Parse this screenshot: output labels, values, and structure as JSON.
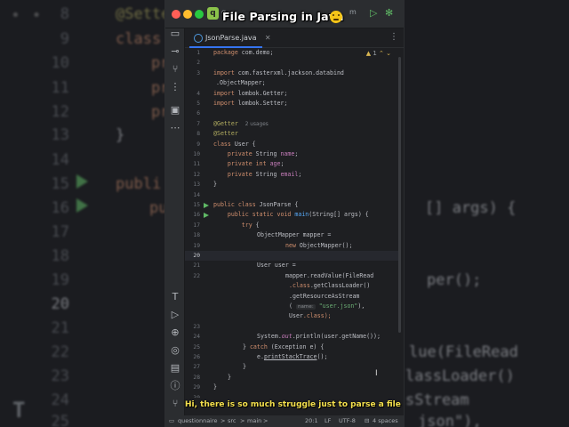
{
  "video_title": "File Parsing in Java",
  "window": {
    "project_badge": "q",
    "project_name_partial": "q",
    "menu_partial": "m"
  },
  "tab": {
    "label": "JsonParse.java"
  },
  "editor": {
    "warning_count": "1",
    "lines": [
      {
        "n": "1"
      },
      {
        "n": "2"
      },
      {
        "n": "3"
      },
      {
        "n": "4"
      },
      {
        "n": "5"
      },
      {
        "n": "6"
      },
      {
        "n": "7"
      },
      {
        "n": "8"
      },
      {
        "n": "9"
      },
      {
        "n": "10"
      },
      {
        "n": "11"
      },
      {
        "n": "12"
      },
      {
        "n": "13"
      },
      {
        "n": "14"
      },
      {
        "n": "15"
      },
      {
        "n": "16"
      },
      {
        "n": "17"
      },
      {
        "n": "18"
      },
      {
        "n": "19"
      },
      {
        "n": "20"
      },
      {
        "n": "21"
      },
      {
        "n": "22"
      },
      {
        "n": "23"
      },
      {
        "n": "24"
      },
      {
        "n": "25"
      },
      {
        "n": "26"
      },
      {
        "n": "27"
      },
      {
        "n": "28"
      },
      {
        "n": "29"
      },
      {
        "n": "30"
      }
    ],
    "code": {
      "package_kw": "package",
      "package_name": " com.demo;",
      "import_kw": "import",
      "import1a": " com.fasterxml.jackson.databind",
      "import1b": ".ObjectMapper;",
      "import2": " lombok.Getter;",
      "import3": " lombok.Setter;",
      "getter": "@Getter",
      "usages": "2 usages",
      "setter": "@Setter",
      "class_kw": "class",
      "class_user": " User {",
      "private_kw": "private",
      "int_kw": "int",
      "string_type": " String ",
      "f_name": "name",
      "f_age": "age",
      "f_email": "email",
      "semi": ";",
      "close_brace": "}",
      "public_kw": "public",
      "static_kw": "static",
      "void_kw": "void",
      "jsonparse_decl": " JsonParse {",
      "main_fn": "main",
      "main_args": "(String[] args) {",
      "try_kw": "try",
      "open_brace": " {",
      "mapper_decl": "ObjectMapper mapper =",
      "new_kw": "new",
      "new_mapper": " ObjectMapper();",
      "user_decl": "User user =",
      "read_value": "mapper.readValue(FileRead",
      "class_ref": ".class",
      "get_cl": ".getClassLoader()",
      "get_res": ".getResourceAsStream",
      "paren_open": "( ",
      "hint_name": "name:",
      "user_json": "\"user.json\"",
      "comma": "),",
      "user_class": "User",
      "class_end": ".class);",
      "sys_out": "System.",
      "out_field": "out",
      "println": ".println(user.getName());",
      "catch_line_a": "} ",
      "catch_kw": "catch",
      "catch_line_b": " (Exception e) {",
      "e_dot": "e.",
      "print_stack": "printStackTrace",
      "print_end": "();"
    }
  },
  "subtitle": "Hi, there is so much struggle just to parse a file",
  "statusbar": {
    "project": "questionnaire",
    "sep1": ">",
    "src": "src",
    "sep2": ">",
    "main": "main",
    "sep3": ">",
    "position": "20:1",
    "line_ending": "LF",
    "encoding": "UTF-8",
    "indent": "4 spaces"
  },
  "background": {
    "dots": "• •",
    "lines": [
      {
        "n": "8"
      },
      {
        "n": "9"
      },
      {
        "n": "10"
      },
      {
        "n": "11"
      },
      {
        "n": "12"
      },
      {
        "n": "13"
      },
      {
        "n": "14"
      },
      {
        "n": "15"
      },
      {
        "n": "16"
      },
      {
        "n": "17"
      },
      {
        "n": "18"
      },
      {
        "n": "19"
      },
      {
        "n": "20"
      },
      {
        "n": "21"
      },
      {
        "n": "22"
      },
      {
        "n": "23"
      },
      {
        "n": "24"
      },
      {
        "n": "25"
      },
      {
        "n": "26"
      }
    ],
    "code_setter": "@Sette",
    "code_class": "class",
    "code_pr1": "pr",
    "code_pr2": "pr",
    "code_pr3": "pr",
    "code_brace": "}",
    "code_public1": "publi",
    "code_public2": "pu",
    "right_args": "[] args) {",
    "right_mapper": "per();",
    "right_readvalue": "lue(FileRead",
    "right_classloader": "lassLoader()",
    "right_stream": "sStream",
    "right_json": "json\"),"
  }
}
